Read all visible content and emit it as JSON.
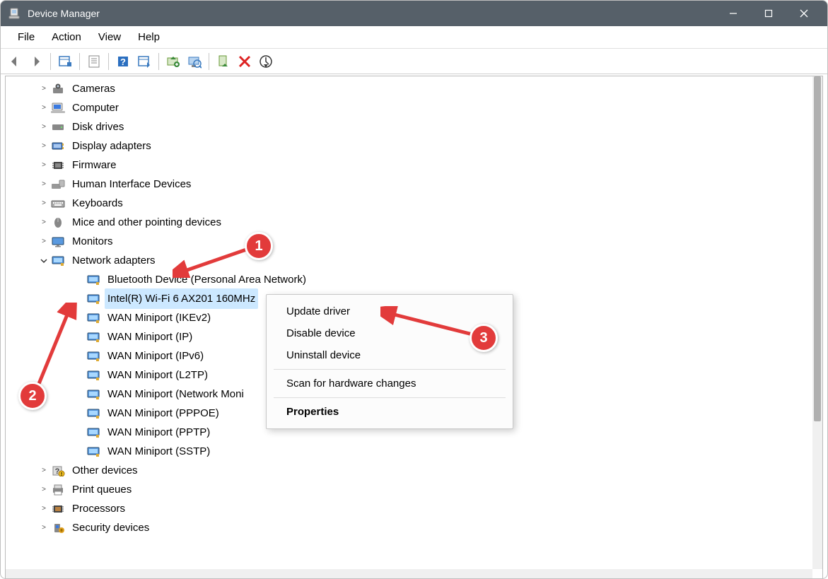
{
  "window": {
    "title": "Device Manager"
  },
  "menus": [
    "File",
    "Action",
    "View",
    "Help"
  ],
  "tree": {
    "cat": {
      "cameras": "Cameras",
      "computer": "Computer",
      "disk": "Disk drives",
      "display": "Display adapters",
      "firmware": "Firmware",
      "hid": "Human Interface Devices",
      "keyboards": "Keyboards",
      "mice": "Mice and other pointing devices",
      "monitors": "Monitors",
      "network": "Network adapters",
      "other": "Other devices",
      "print": "Print queues",
      "processors": "Processors",
      "security": "Security devices"
    },
    "net": {
      "bt": "Bluetooth Device (Personal Area Network)",
      "wifi": "Intel(R) Wi-Fi 6 AX201 160MHz",
      "ikev2": "WAN Miniport (IKEv2)",
      "ip": "WAN Miniport (IP)",
      "ipv6": "WAN Miniport (IPv6)",
      "l2tp": "WAN Miniport (L2TP)",
      "netmon": "WAN Miniport (Network Moni",
      "pppoe": "WAN Miniport (PPPOE)",
      "pptp": "WAN Miniport (PPTP)",
      "sstp": "WAN Miniport (SSTP)"
    }
  },
  "context_menu": {
    "update": "Update driver",
    "disable": "Disable device",
    "uninstall": "Uninstall device",
    "scan": "Scan for hardware changes",
    "properties": "Properties"
  },
  "annotations": {
    "c1": "1",
    "c2": "2",
    "c3": "3"
  }
}
